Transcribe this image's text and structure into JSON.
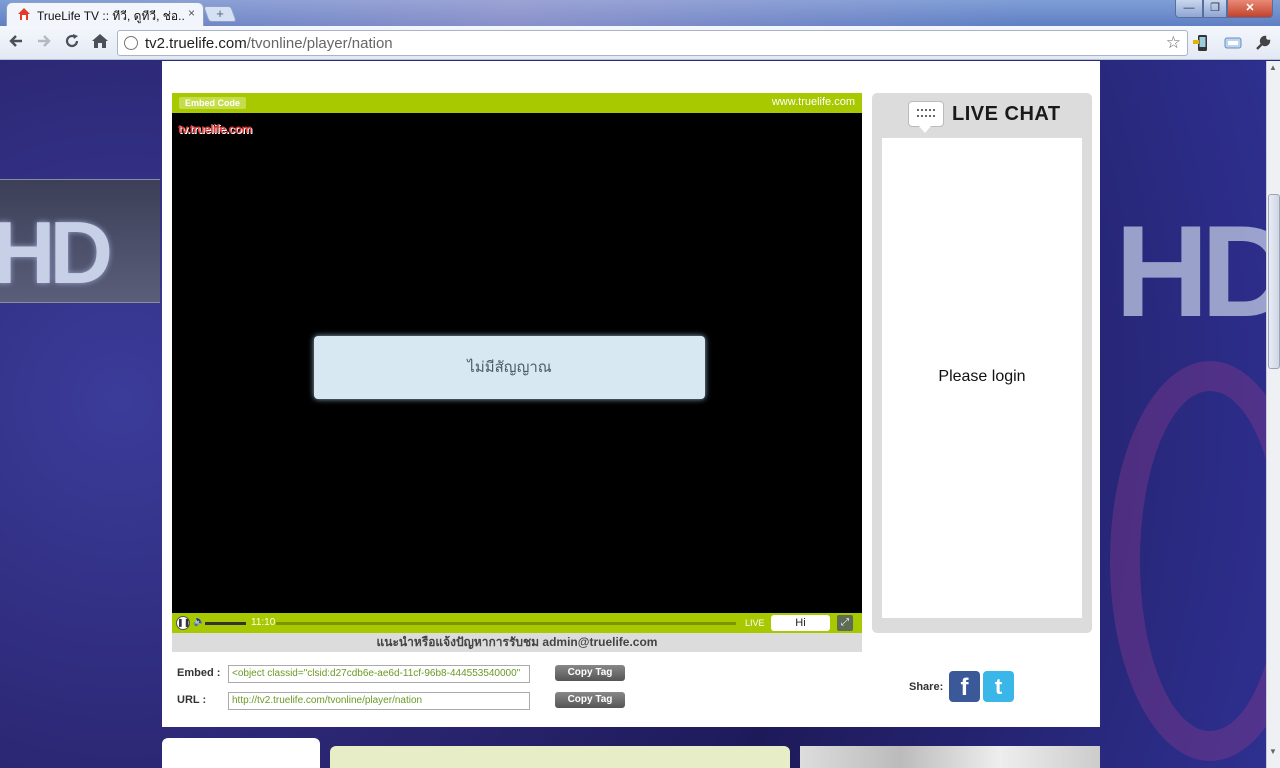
{
  "browser": {
    "tab_title": "TrueLife TV :: ทีวี, ดูทีวี, ช่อ...",
    "tab_close": "×",
    "new_tab": "+",
    "url_domain": "tv2.truelife.com",
    "url_path": "/tvonline/player/nation",
    "window_minimize": "—",
    "window_maximize": "❐",
    "window_close": "✕"
  },
  "player": {
    "embed_code_label": "Embed Code",
    "site_label": "www.truelife.com",
    "watermark": "tv.truelife.com",
    "no_signal_message": "ไม่มีสัญญาณ",
    "elapsed_time": "11:10",
    "live_label": "LIVE",
    "quality_label": "Hi",
    "support_text": "แนะนำหรือแจ้งปัญหาการรับชม admin@truelife.com"
  },
  "chat": {
    "title": "LIVE CHAT",
    "login_prompt": "Please login"
  },
  "embed": {
    "embed_label": "Embed :",
    "embed_value": "<object classid=\"clsid:d27cdb6e-ae6d-11cf-96b8-444553540000\"",
    "url_label": "URL :",
    "url_value": "http://tv2.truelife.com/tvonline/player/nation",
    "copy_tag_label": "Copy Tag"
  },
  "share": {
    "label": "Share:",
    "facebook_glyph": "f",
    "twitter_glyph": "t"
  },
  "colors": {
    "player_accent": "#a8c800",
    "page_background": "#2a2570",
    "facebook": "#3b5998",
    "twitter": "#3ab6e8"
  }
}
